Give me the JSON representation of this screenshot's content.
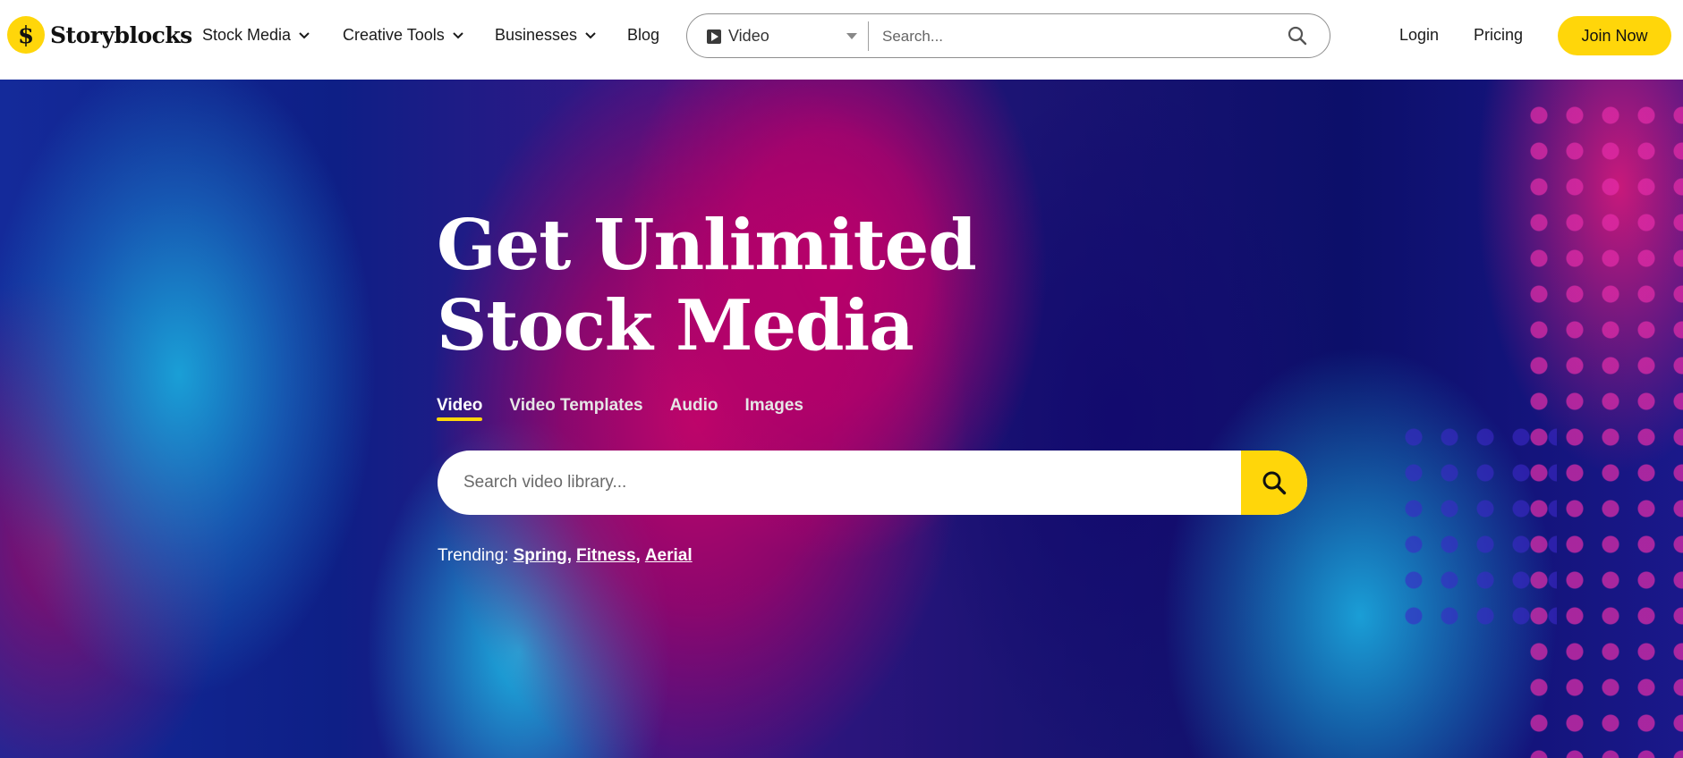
{
  "brand": {
    "name": "Storyblocks",
    "logo_glyph": "$",
    "accent": "#ffd60a"
  },
  "nav": {
    "items": [
      {
        "label": "Stock Media",
        "has_dropdown": true
      },
      {
        "label": "Creative Tools",
        "has_dropdown": true
      },
      {
        "label": "Businesses",
        "has_dropdown": true
      },
      {
        "label": "Blog",
        "has_dropdown": false
      }
    ],
    "search": {
      "type_label": "Video",
      "placeholder": "Search..."
    },
    "login_label": "Login",
    "pricing_label": "Pricing",
    "join_label": "Join Now"
  },
  "hero": {
    "title_line1": "Get Unlimited",
    "title_line2": "Stock Media",
    "tabs": [
      {
        "label": "Video",
        "active": true
      },
      {
        "label": "Video Templates",
        "active": false
      },
      {
        "label": "Audio",
        "active": false
      },
      {
        "label": "Images",
        "active": false
      }
    ],
    "search_placeholder": "Search video library...",
    "trending_label": "Trending:",
    "trending": [
      "Spring,",
      "Fitness,",
      "Aerial"
    ]
  }
}
